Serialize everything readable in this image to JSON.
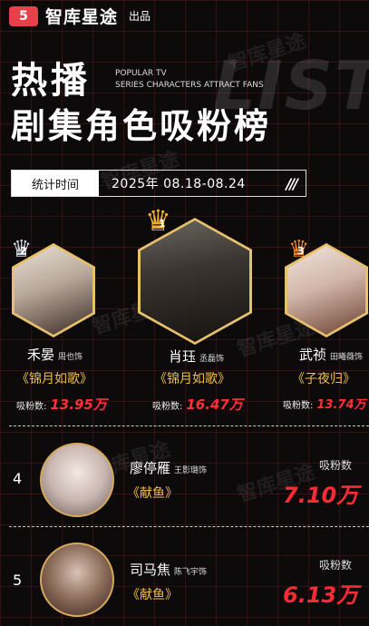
{
  "brand": {
    "logo": "5",
    "name": "智库星途",
    "sub": "出品"
  },
  "header": {
    "hot": "热播",
    "en_line1": "POPULAR TV",
    "en_line2": "SERIES CHARACTERS ATTRACT FANS",
    "bg_word": "LIST",
    "title": "剧集角色吸粉榜"
  },
  "stat": {
    "label": "统计时间",
    "date": "2025年  08.18-08.24",
    "slashes": "///"
  },
  "watermark": "智库星途",
  "podium": [
    {
      "rank": "2",
      "name": "禾晏",
      "actor": "周也饰",
      "drama": "《锦月如歌》",
      "fans_label": "吸粉数:",
      "fans": "13.95万",
      "crown_icon": "silver-crown"
    },
    {
      "rank": "1",
      "name": "肖珏",
      "actor": "丞磊饰",
      "drama": "《锦月如歌》",
      "fans_label": "吸粉数:",
      "fans": "16.47万",
      "crown_icon": "gold-crown"
    },
    {
      "rank": "3",
      "name": "武祯",
      "actor": "田曦薇饰",
      "drama": "《子夜归》",
      "fans_label": "吸粉数:",
      "fans": "13.74万",
      "crown_icon": "bronze-crown"
    }
  ],
  "list": [
    {
      "rank": "4",
      "name": "廖停雁",
      "actor": "王影璐饰",
      "drama": "《献鱼》",
      "fans_label": "吸粉数",
      "fans": "7.10万"
    },
    {
      "rank": "5",
      "name": "司马焦",
      "actor": "陈飞宇饰",
      "drama": "《献鱼》",
      "fans_label": "吸粉数",
      "fans": "6.13万"
    }
  ],
  "colors": {
    "accent_red": "#ff3038",
    "gold": "#f0c04a",
    "grid": "#781e28"
  }
}
